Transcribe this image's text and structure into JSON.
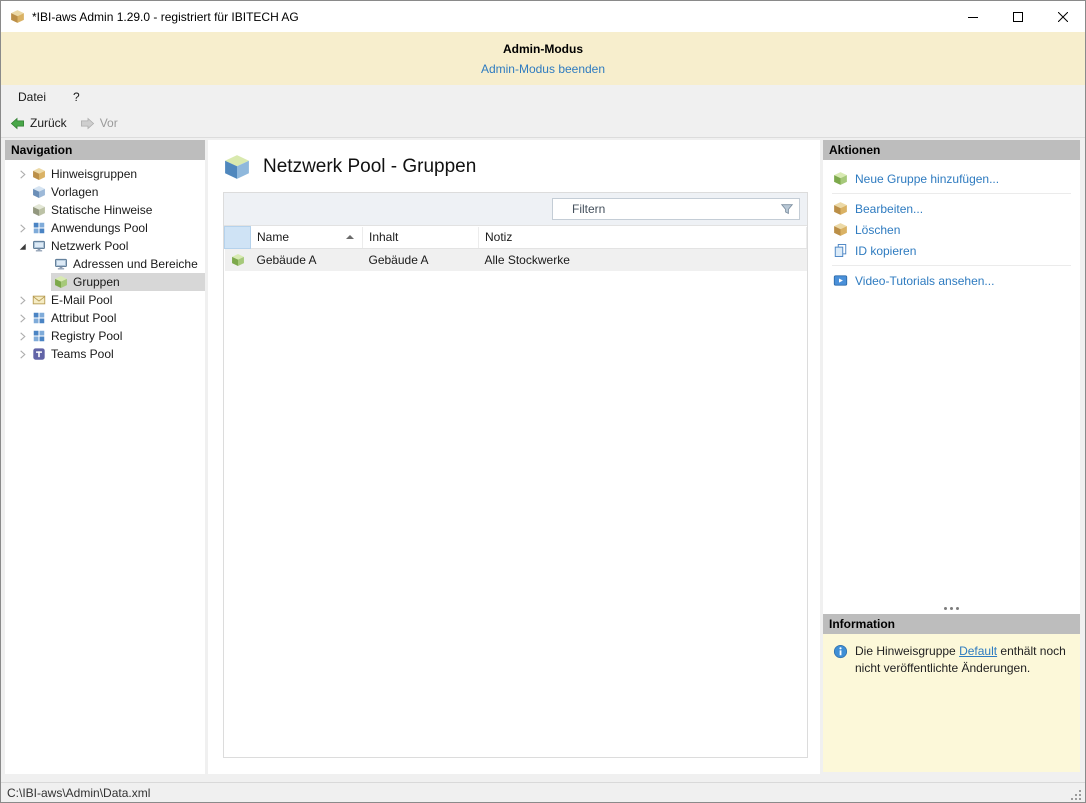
{
  "window": {
    "title": "*IBI-aws Admin 1.29.0 - registriert für IBITECH AG"
  },
  "admin_banner": {
    "title": "Admin-Modus",
    "link_label": "Admin-Modus beenden"
  },
  "menubar": {
    "items": [
      {
        "label": "Datei"
      },
      {
        "label": "?"
      }
    ]
  },
  "toolbar": {
    "back_label": "Zurück",
    "forward_label": "Vor"
  },
  "navigation": {
    "header": "Navigation",
    "items": [
      {
        "label": "Hinweisgruppen",
        "level": 1,
        "state": "collapsed",
        "icon": "package-icon"
      },
      {
        "label": "Vorlagen",
        "level": 1,
        "state": "leaf",
        "icon": "package-icon"
      },
      {
        "label": "Statische Hinweise",
        "level": 1,
        "state": "leaf",
        "icon": "package-icon"
      },
      {
        "label": "Anwendungs Pool",
        "level": 1,
        "state": "collapsed",
        "icon": "app-grid-icon"
      },
      {
        "label": "Netzwerk Pool",
        "level": 1,
        "state": "expanded",
        "icon": "network-monitor-icon"
      },
      {
        "label": "Adressen und Bereiche",
        "level": 2,
        "state": "leaf",
        "icon": "network-monitor-icon"
      },
      {
        "label": "Gruppen",
        "level": 2,
        "state": "leaf",
        "icon": "package-icon",
        "selected": true
      },
      {
        "label": "E-Mail Pool",
        "level": 1,
        "state": "collapsed",
        "icon": "envelope-icon"
      },
      {
        "label": "Attribut Pool",
        "level": 1,
        "state": "collapsed",
        "icon": "app-grid-icon"
      },
      {
        "label": "Registry Pool",
        "level": 1,
        "state": "collapsed",
        "icon": "app-grid-icon"
      },
      {
        "label": "Teams Pool",
        "level": 1,
        "state": "collapsed",
        "icon": "teams-icon"
      }
    ]
  },
  "content": {
    "title": "Netzwerk Pool - Gruppen",
    "filter": {
      "placeholder": "Filtern"
    },
    "table": {
      "columns": [
        {
          "label": "Name",
          "sort": "ascending"
        },
        {
          "label": "Inhalt"
        },
        {
          "label": "Notiz"
        }
      ],
      "rows": [
        {
          "name": "Gebäude A",
          "inhalt": "Gebäude A",
          "notiz": "Alle Stockwerke"
        }
      ]
    }
  },
  "actions": {
    "header": "Aktionen",
    "items": [
      {
        "label": "Neue Gruppe hinzufügen...",
        "icon": "package-add-icon"
      },
      {
        "label": "Bearbeiten...",
        "icon": "package-edit-icon"
      },
      {
        "label": "Löschen",
        "icon": "package-delete-icon"
      },
      {
        "label": "ID kopieren",
        "icon": "copy-icon"
      },
      {
        "label": "Video-Tutorials ansehen...",
        "icon": "video-icon"
      }
    ]
  },
  "information": {
    "header": "Information",
    "message_prefix": "Die Hinweisgruppe ",
    "link_label": "Default",
    "message_suffix": " enthält noch nicht veröffentlichte Änderungen."
  },
  "statusbar": {
    "path": "C:\\IBI-aws\\Admin\\Data.xml"
  },
  "colors": {
    "link_blue": "#2e7bc0",
    "banner_background": "#f7eecd",
    "info_background": "#fcf8d9",
    "header_gray": "#bdbdbd",
    "selection_gray": "#d7d7d7"
  }
}
